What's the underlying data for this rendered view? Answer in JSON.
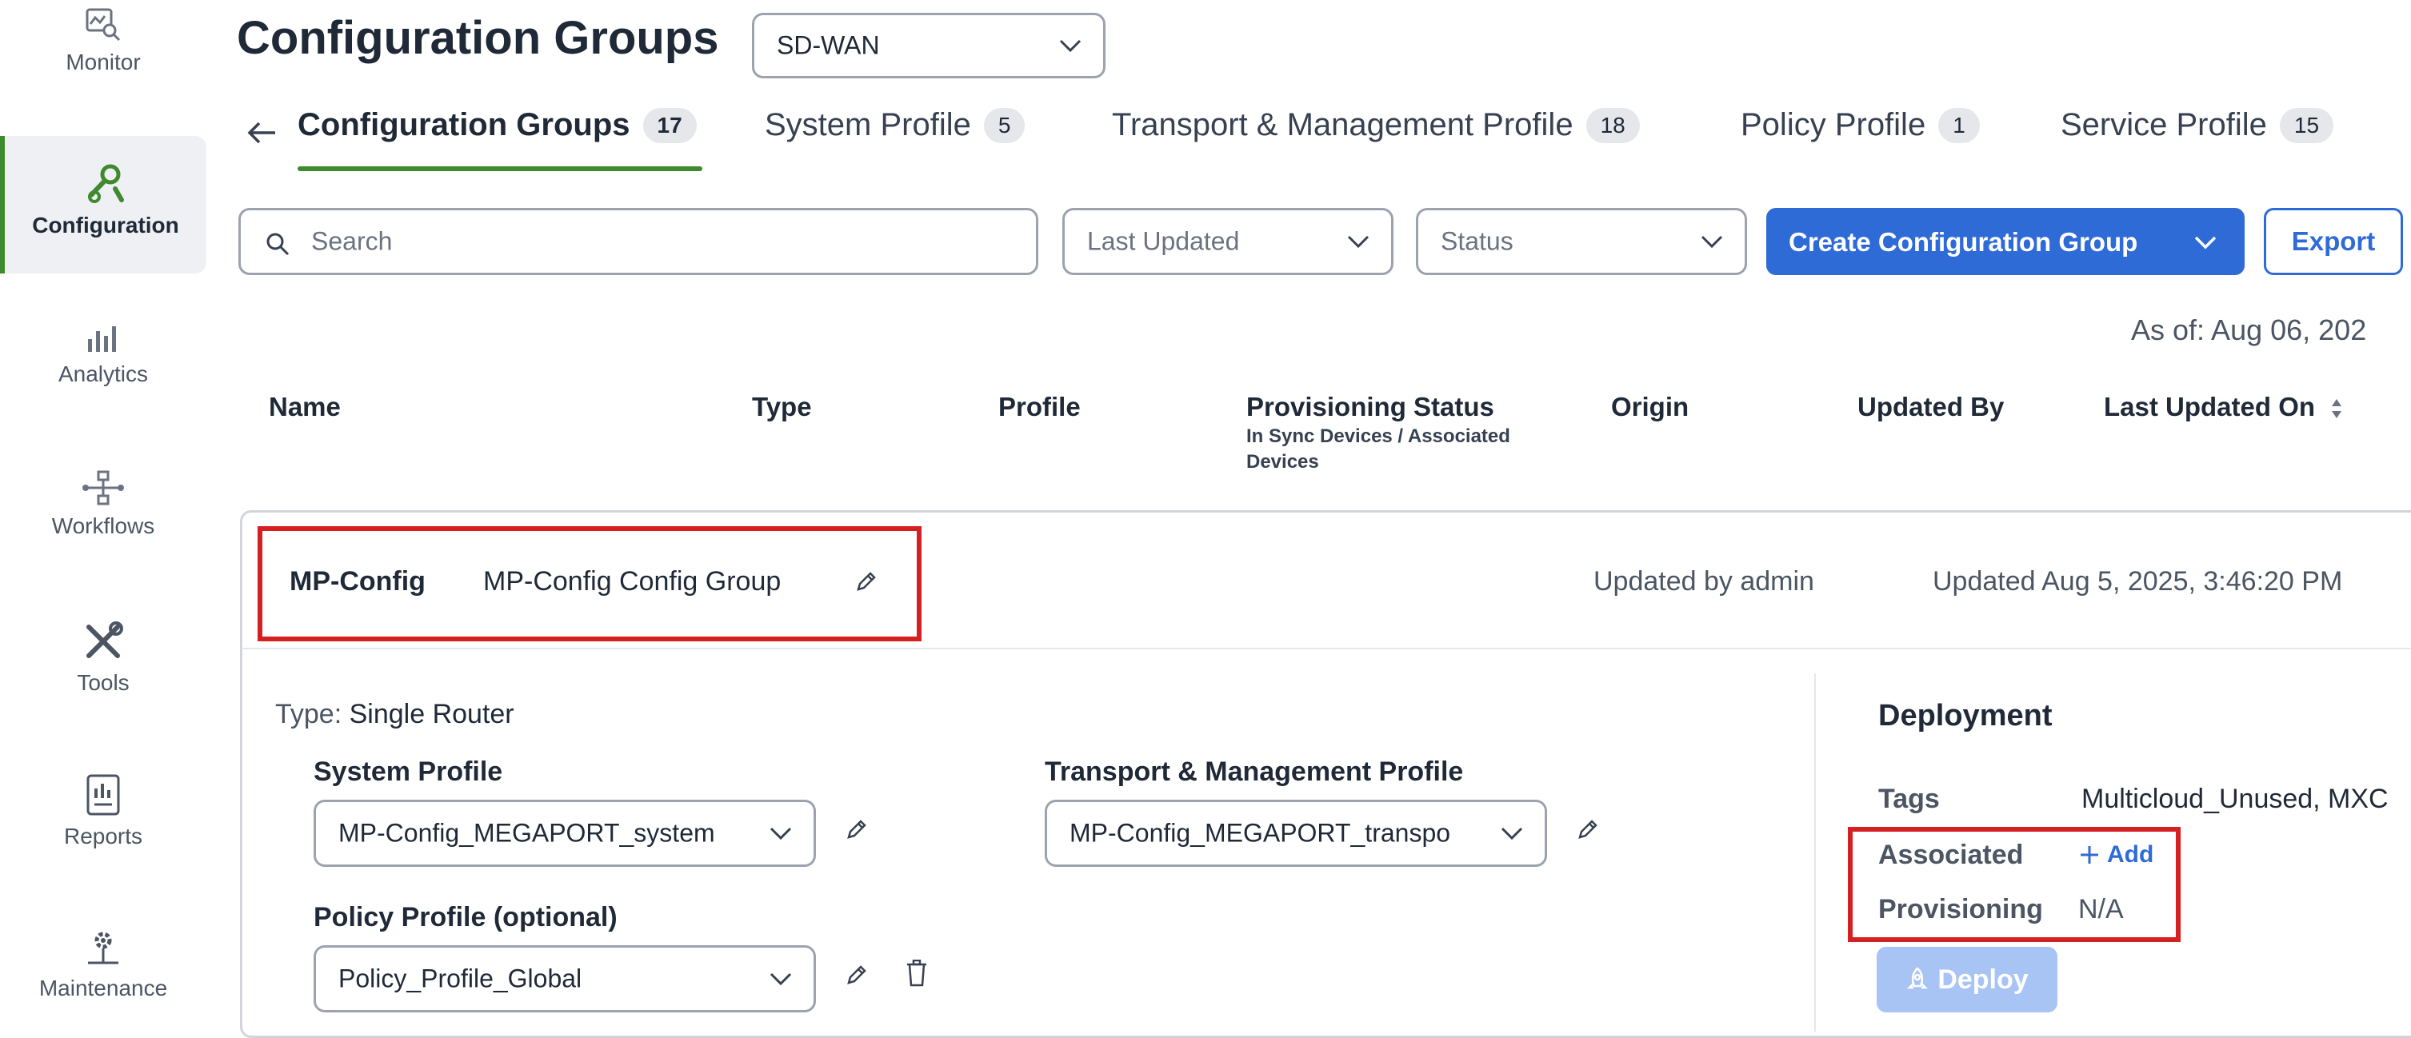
{
  "sidebar": {
    "items": [
      {
        "label": "Monitor",
        "icon": "monitor-icon"
      },
      {
        "label": "Configuration",
        "icon": "wrench-icon"
      },
      {
        "label": "Analytics",
        "icon": "bar-chart-icon"
      },
      {
        "label": "Workflows",
        "icon": "workflow-icon"
      },
      {
        "label": "Tools",
        "icon": "tools-icon"
      },
      {
        "label": "Reports",
        "icon": "report-icon"
      },
      {
        "label": "Maintenance",
        "icon": "maintenance-icon"
      }
    ]
  },
  "header": {
    "title": "Configuration Groups",
    "scope_select": "SD-WAN"
  },
  "tabs": [
    {
      "label": "Configuration Groups",
      "count": "17"
    },
    {
      "label": "System Profile",
      "count": "5"
    },
    {
      "label": "Transport & Management Profile",
      "count": "18"
    },
    {
      "label": "Policy Profile",
      "count": "1"
    },
    {
      "label": "Service Profile",
      "count": "15"
    }
  ],
  "toolbar": {
    "search_placeholder": "Search",
    "last_updated": "Last Updated",
    "status": "Status",
    "create_label": "Create Configuration Group",
    "export_label": "Export",
    "as_of": "As of: Aug 06, 202"
  },
  "table": {
    "columns": {
      "name": "Name",
      "type": "Type",
      "profile": "Profile",
      "provisioning": "Provisioning Status",
      "provisioning_sub1": "In Sync Devices / Associated",
      "provisioning_sub2": "Devices",
      "origin": "Origin",
      "updated_by": "Updated By",
      "last_updated_on": "Last Updated On"
    }
  },
  "group": {
    "name": "MP-Config",
    "description": "MP-Config Config Group",
    "updated_by": "Updated by admin",
    "updated_on": "Updated Aug 5, 2025, 3:46:20 PM",
    "type_label": "Type:",
    "type_value": "Single Router",
    "system_profile_label": "System Profile",
    "system_profile_value": "MP-Config_MEGAPORT_system",
    "transport_profile_label": "Transport & Management Profile",
    "transport_profile_value": "MP-Config_MEGAPORT_transpo",
    "policy_profile_label": "Policy Profile (optional)",
    "policy_profile_value": "Policy_Profile_Global"
  },
  "deployment": {
    "title": "Deployment",
    "tags_label": "Tags",
    "tags_value": "Multicloud_Unused, MXC",
    "associated_label": "Associated",
    "add_label": "Add",
    "provisioning_label": "Provisioning",
    "provisioning_value": "N/A",
    "deploy_label": "Deploy"
  },
  "colors": {
    "accent_green": "#3f8a2e",
    "primary_blue": "#2f6bd6",
    "highlight_red": "#d42020"
  }
}
